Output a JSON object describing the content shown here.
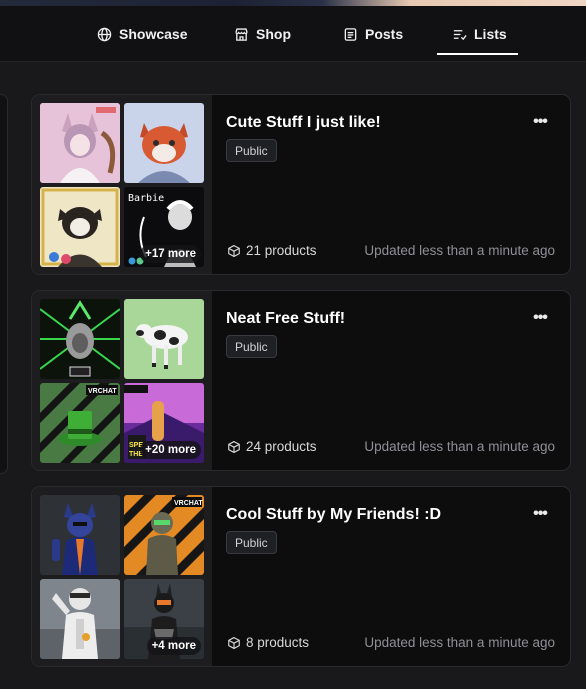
{
  "nav": {
    "tabs": [
      {
        "label": "Showcase",
        "icon": "globe-icon",
        "active": false
      },
      {
        "label": "Shop",
        "icon": "store-icon",
        "active": false
      },
      {
        "label": "Posts",
        "icon": "document-icon",
        "active": false
      },
      {
        "label": "Lists",
        "icon": "list-icon",
        "active": true
      }
    ]
  },
  "lists": [
    {
      "title": "Cute Stuff I just like!",
      "visibility": "Public",
      "products": "21 products",
      "updated": "Updated less than a minute ago",
      "more": "+17 more",
      "menu": "•••"
    },
    {
      "title": "Neat Free Stuff!",
      "visibility": "Public",
      "products": "24 products",
      "updated": "Updated less than a minute ago",
      "more": "+20 more",
      "menu": "•••"
    },
    {
      "title": "Cool Stuff by My Friends! :D",
      "visibility": "Public",
      "products": "8 products",
      "updated": "Updated less than a minute ago",
      "more": "+4 more",
      "menu": "•••"
    }
  ],
  "thumb_text": {
    "barbie": "Barbie",
    "vrchat": "VRCHAT"
  },
  "colors": {
    "background": "#19191b",
    "card": "#0d0d0e",
    "navbar": "#111113",
    "muted_text": "#8f9096"
  }
}
